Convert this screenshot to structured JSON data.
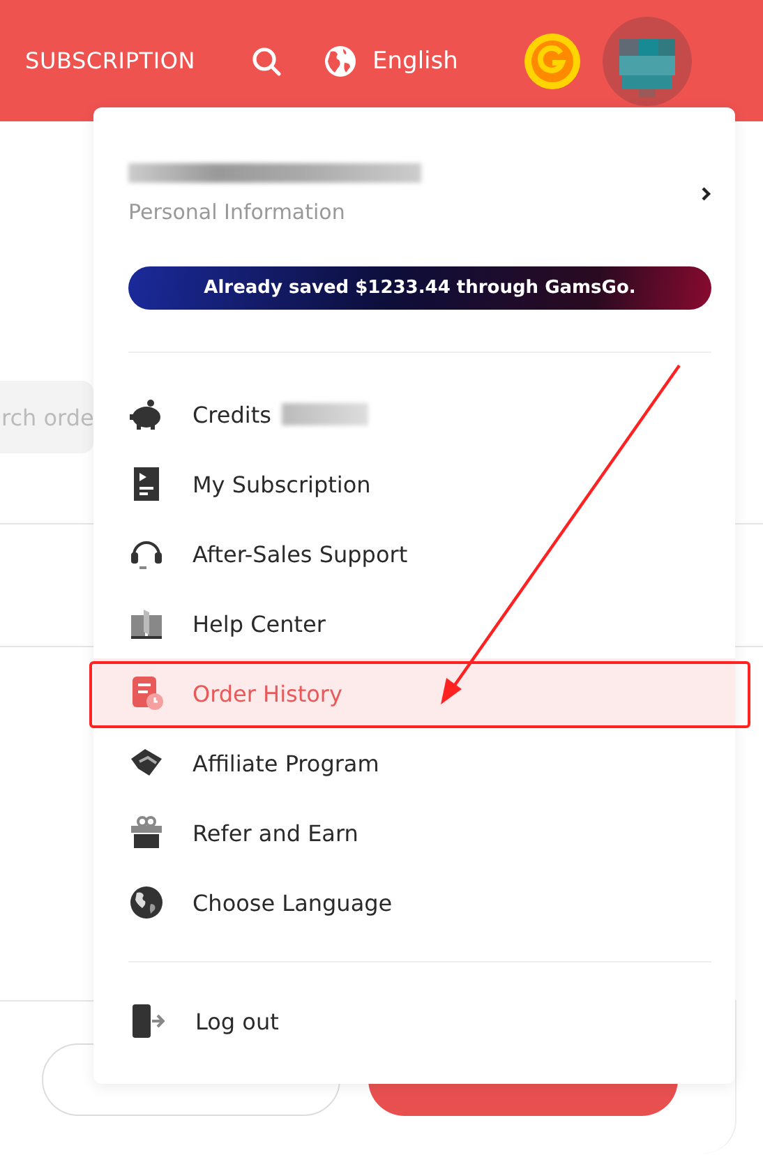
{
  "header": {
    "nav_label": "SUBSCRIPTION",
    "language": "English"
  },
  "background": {
    "search": {
      "placeholder": "rch orde"
    }
  },
  "menu": {
    "profile_label": "Personal Information",
    "banner": "Already saved **$1233.44** through GamsGo.",
    "items": [
      {
        "kind": "credits",
        "label": "Credits",
        "selected": false
      },
      {
        "kind": "subscription",
        "label": "My Subscription",
        "selected": false
      },
      {
        "kind": "support",
        "label": "After-Sales Support",
        "selected": false
      },
      {
        "kind": "help",
        "label": "Help Center",
        "selected": false
      },
      {
        "kind": "orders",
        "label": "Order History",
        "selected": true
      },
      {
        "kind": "affiliate",
        "label": "Affiliate Program",
        "selected": false
      },
      {
        "kind": "refer",
        "label": "Refer and Earn",
        "selected": false
      },
      {
        "kind": "language",
        "label": "Choose Language",
        "selected": false
      }
    ],
    "logout": "Log out"
  }
}
